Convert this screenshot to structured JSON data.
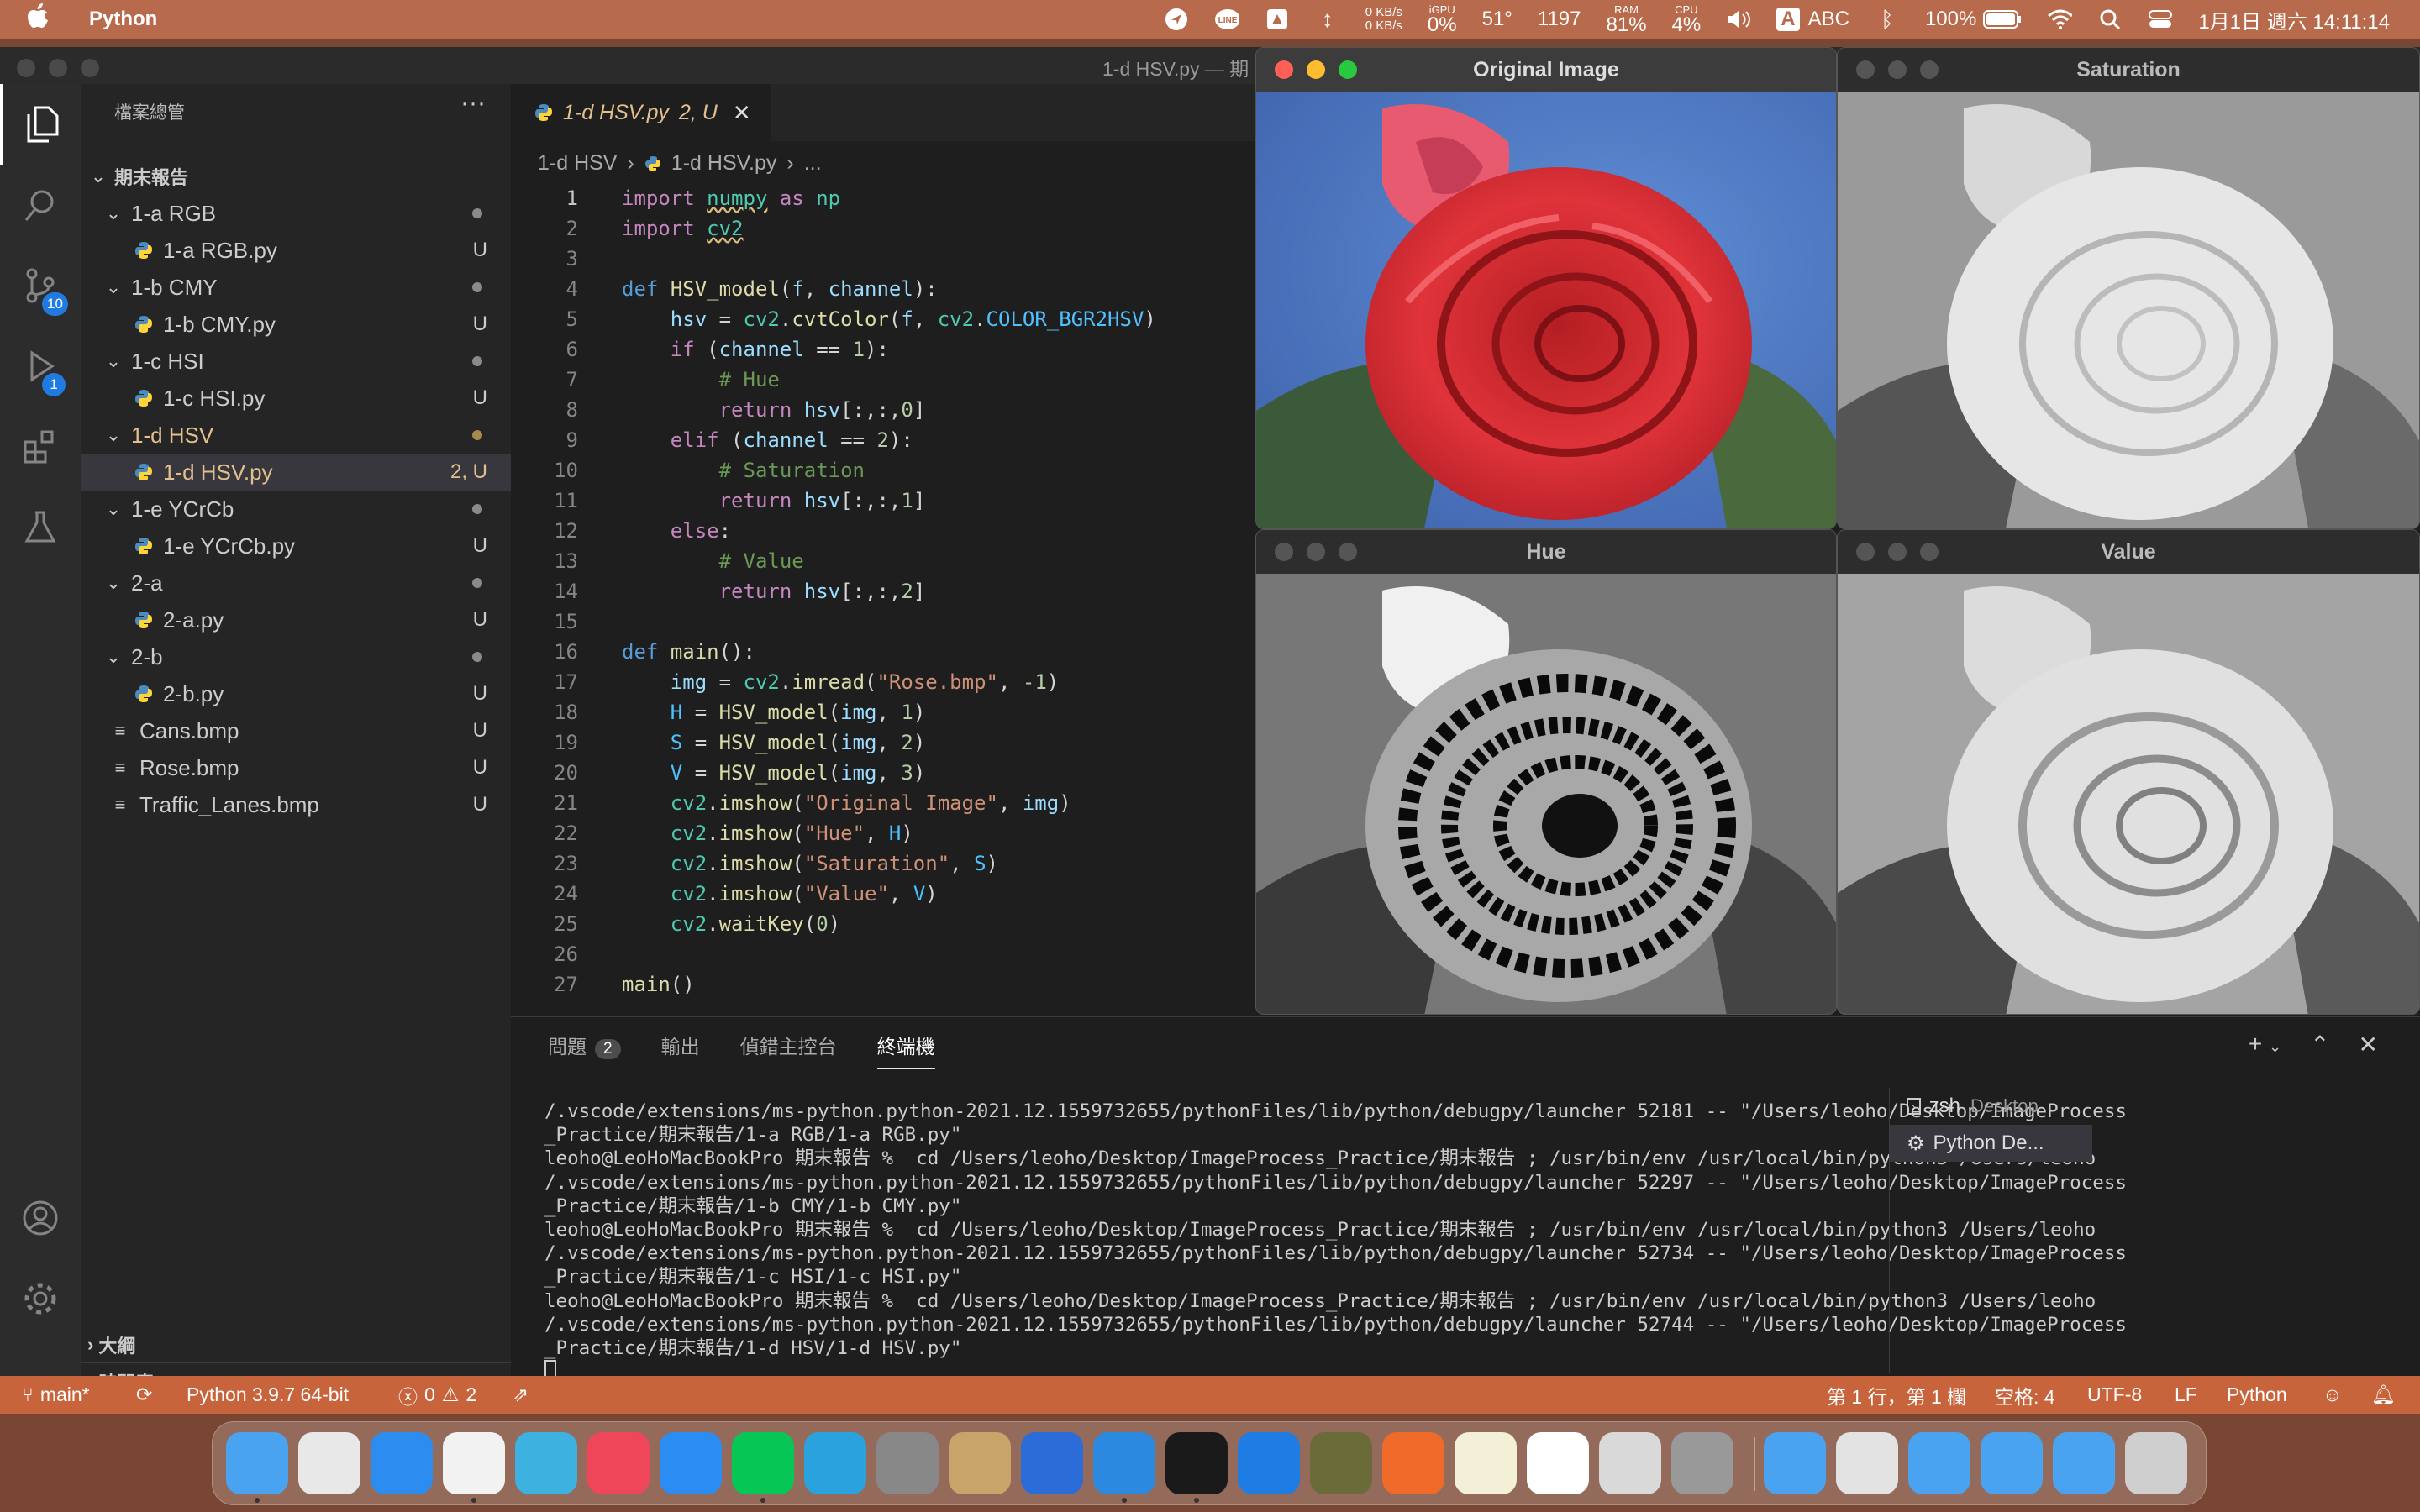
{
  "menubar": {
    "app_name": "Python",
    "net_up": "0 KB/s",
    "net_down": "0 KB/s",
    "igpu_label": "iGPU",
    "igpu": "0%",
    "temp": "51°",
    "fan": "1197",
    "ram_label": "RAM",
    "ram": "81%",
    "cpu_label": "CPU",
    "cpu": "4%",
    "input_source": "ABC",
    "input_badge": "A",
    "battery": "100%",
    "datetime": "1月1日 週六  14:11:14"
  },
  "window": {
    "title": "1-d HSV.py — 期"
  },
  "sidebar": {
    "title": "檔案總管",
    "more": "···",
    "root": "期末報告",
    "items": [
      {
        "label": "1-a RGB",
        "type": "folder",
        "status": "dot"
      },
      {
        "label": "1-a RGB.py",
        "type": "py",
        "status": "U"
      },
      {
        "label": "1-b CMY",
        "type": "folder",
        "status": "dot"
      },
      {
        "label": "1-b CMY.py",
        "type": "py",
        "status": "U"
      },
      {
        "label": "1-c HSI",
        "type": "folder",
        "status": "dot"
      },
      {
        "label": "1-c HSI.py",
        "type": "py",
        "status": "U"
      },
      {
        "label": "1-d HSV",
        "type": "folder",
        "status": "dot"
      },
      {
        "label": "1-d HSV.py",
        "type": "py",
        "status": "2, U"
      },
      {
        "label": "1-e YCrCb",
        "type": "folder",
        "status": "dot"
      },
      {
        "label": "1-e YCrCb.py",
        "type": "py",
        "status": "U"
      },
      {
        "label": "2-a",
        "type": "folder",
        "status": "dot"
      },
      {
        "label": "2-a.py",
        "type": "py",
        "status": "U"
      },
      {
        "label": "2-b",
        "type": "folder",
        "status": "dot"
      },
      {
        "label": "2-b.py",
        "type": "py",
        "status": "U"
      },
      {
        "label": "Cans.bmp",
        "type": "file",
        "status": "U"
      },
      {
        "label": "Rose.bmp",
        "type": "file",
        "status": "U"
      },
      {
        "label": "Traffic_Lanes.bmp",
        "type": "file",
        "status": "U"
      }
    ],
    "outline": "大綱",
    "timeline": "時間表"
  },
  "activity": {
    "scm_badge": "10",
    "debug_badge": "1"
  },
  "editor": {
    "tab_label": "1-d HSV.py",
    "tab_status": "2, U",
    "breadcrumb": [
      "1-d HSV",
      "1-d HSV.py",
      "..."
    ]
  },
  "panel": {
    "tabs": [
      "問題",
      "輸出",
      "偵錯主控台",
      "終端機"
    ],
    "problems_count": "2",
    "terminal_lines": [
      "/.vscode/extensions/ms-python.python-2021.12.1559732655/pythonFiles/lib/python/debugpy/launcher 52181 -- \"/Users/leoho/Desktop/ImageProcess",
      "_Practice/期末報告/1-a RGB/1-a RGB.py\"",
      "leoho@LeoHoMacBookPro 期末報告 %  cd /Users/leoho/Desktop/ImageProcess_Practice/期末報告 ; /usr/bin/env /usr/local/bin/python3 /Users/leoho",
      "/.vscode/extensions/ms-python.python-2021.12.1559732655/pythonFiles/lib/python/debugpy/launcher 52297 -- \"/Users/leoho/Desktop/ImageProcess",
      "_Practice/期末報告/1-b CMY/1-b CMY.py\"",
      "leoho@LeoHoMacBookPro 期末報告 %  cd /Users/leoho/Desktop/ImageProcess_Practice/期末報告 ; /usr/bin/env /usr/local/bin/python3 /Users/leoho",
      "/.vscode/extensions/ms-python.python-2021.12.1559732655/pythonFiles/lib/python/debugpy/launcher 52734 -- \"/Users/leoho/Desktop/ImageProcess",
      "_Practice/期末報告/1-c HSI/1-c HSI.py\"",
      "leoho@LeoHoMacBookPro 期末報告 %  cd /Users/leoho/Desktop/ImageProcess_Practice/期末報告 ; /usr/bin/env /usr/local/bin/python3 /Users/leoho",
      "/.vscode/extensions/ms-python.python-2021.12.1559732655/pythonFiles/lib/python/debugpy/launcher 52744 -- \"/Users/leoho/Desktop/ImageProcess",
      "_Practice/期末報告/1-d HSV/1-d HSV.py\""
    ],
    "terminals": [
      {
        "name": "zsh",
        "detail": "Desktop"
      },
      {
        "name": "Python De...",
        "detail": ""
      }
    ]
  },
  "statusbar": {
    "branch": "main*",
    "interpreter": "Python 3.9.7 64-bit",
    "errors": "0",
    "warnings": "2",
    "position": "第 1 行，第 1 欄",
    "spaces": "空格: 4",
    "encoding": "UTF-8",
    "eol": "LF",
    "language": "Python"
  },
  "image_windows": {
    "original": "Original Image",
    "saturation": "Saturation",
    "hue": "Hue",
    "value": "Value"
  },
  "icons": [
    "apple-icon",
    "explorer-icon",
    "search-icon",
    "source-control-icon",
    "run-debug-icon",
    "extensions-icon",
    "testing-icon",
    "account-icon",
    "settings-icon",
    "python-file-icon",
    "branch-icon",
    "sync-icon"
  ],
  "colors": {
    "accent": "#c8643c",
    "modified": "#e2c08d",
    "badge": "#1f7be0"
  }
}
